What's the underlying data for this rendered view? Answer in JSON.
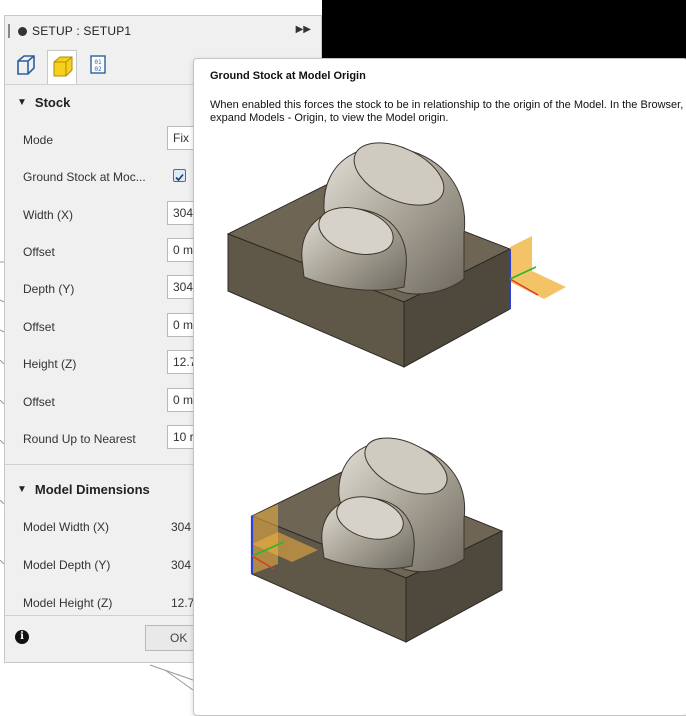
{
  "panel": {
    "title": "SETUP : SETUP1",
    "tabs": [
      {
        "name": "setup-tab-icon"
      },
      {
        "name": "stock-tab-icon",
        "active": true
      },
      {
        "name": "post-process-tab-icon",
        "glyph": "01\n02"
      }
    ],
    "stock_section": {
      "heading": "Stock",
      "rows": [
        {
          "label": "Mode",
          "value": "Fix"
        },
        {
          "label": "Ground Stock at Moc...",
          "checked": true
        },
        {
          "label": "Width (X)",
          "value": "304"
        },
        {
          "label": "Offset",
          "value": "0 m"
        },
        {
          "label": "Depth (Y)",
          "value": "304"
        },
        {
          "label": "Offset",
          "value": "0 m"
        },
        {
          "label": "Height (Z)",
          "value": "12.7"
        },
        {
          "label": "Offset",
          "value": "0 m"
        },
        {
          "label": "Round Up to Nearest",
          "value": "10 r"
        }
      ]
    },
    "model_section": {
      "heading": "Model Dimensions",
      "rows": [
        {
          "label": "Model Width (X)",
          "value": "304"
        },
        {
          "label": "Model Depth (Y)",
          "value": "304"
        },
        {
          "label": "Model Height (Z)",
          "value": "12.7"
        }
      ]
    },
    "footer": {
      "ok_label": "OK",
      "info_glyph": "i"
    }
  },
  "tooltip": {
    "title": "Ground Stock at Model Origin",
    "description": "When enabled this forces the stock to be in relationship to the origin of the Model. In the Browser, expand Models - Origin, to view the Model origin."
  },
  "colors": {
    "stock_top": "#6e6555",
    "stock_side_dark": "#4f483c",
    "stock_side_light": "#5f5748",
    "model_light": "#d9d5cc",
    "model_dark": "#7c766b",
    "origin_plane": "#f2b441"
  }
}
